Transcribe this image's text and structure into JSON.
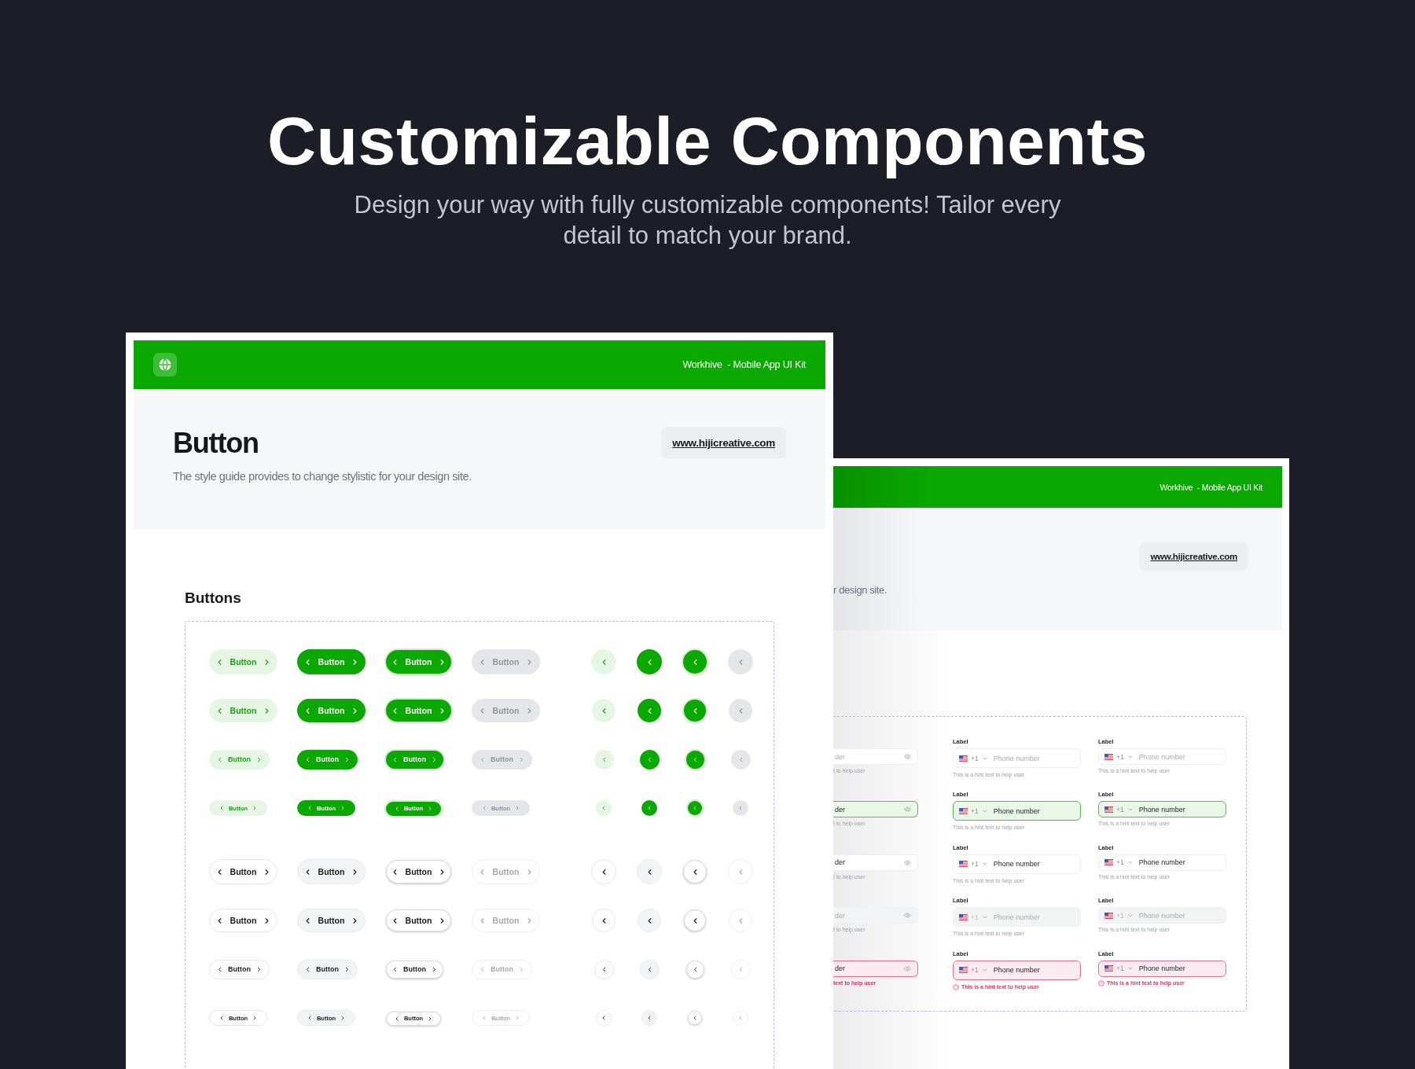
{
  "hero": {
    "title": "Customizable Components",
    "subtitle": "Design your way with fully customizable components! Tailor every detail to match your brand."
  },
  "front_card": {
    "brand": "Workhive  - Mobile App UI Kit",
    "title": "Button",
    "description": "The style guide provides to change stylistic for your design site.",
    "link": "www.hijicreative.com",
    "section_title": "Buttons",
    "button_groups": [
      {
        "rows": [
          {
            "buttons": [
              {
                "label": "Button",
                "disabled": false
              },
              {
                "label": "Button",
                "disabled": false
              },
              {
                "label": "Button",
                "disabled": false
              },
              {
                "label": "Button",
                "disabled": true
              }
            ],
            "icon_buttons": [
              {
                "disabled": false
              },
              {
                "disabled": false
              },
              {
                "disabled": false
              },
              {
                "disabled": true
              }
            ]
          },
          {
            "buttons": [
              {
                "label": "Button",
                "disabled": false
              },
              {
                "label": "Button",
                "disabled": false
              },
              {
                "label": "Button",
                "disabled": false
              },
              {
                "label": "Button",
                "disabled": true
              }
            ],
            "icon_buttons": [
              {
                "disabled": false
              },
              {
                "disabled": false
              },
              {
                "disabled": false
              },
              {
                "disabled": true
              }
            ]
          },
          {
            "buttons": [
              {
                "label": "Button",
                "disabled": false
              },
              {
                "label": "Button",
                "disabled": false
              },
              {
                "label": "Button",
                "disabled": false
              },
              {
                "label": "Button",
                "disabled": true
              }
            ],
            "icon_buttons": [
              {
                "disabled": false
              },
              {
                "disabled": false
              },
              {
                "disabled": false
              },
              {
                "disabled": true
              }
            ]
          },
          {
            "buttons": [
              {
                "label": "Button",
                "disabled": false
              },
              {
                "label": "Button",
                "disabled": false
              },
              {
                "label": "Button",
                "disabled": false
              },
              {
                "label": "Button",
                "disabled": true
              }
            ],
            "icon_buttons": [
              {
                "disabled": false
              },
              {
                "disabled": false
              },
              {
                "disabled": false
              },
              {
                "disabled": true
              }
            ]
          }
        ]
      },
      {
        "rows": [
          {
            "buttons": [
              {
                "label": "Button",
                "disabled": false
              },
              {
                "label": "Button",
                "disabled": false
              },
              {
                "label": "Button",
                "disabled": false
              },
              {
                "label": "Button",
                "disabled": true
              }
            ],
            "icon_buttons": [
              {
                "disabled": false
              },
              {
                "disabled": false
              },
              {
                "disabled": false
              },
              {
                "disabled": true
              }
            ]
          },
          {
            "buttons": [
              {
                "label": "Button",
                "disabled": false
              },
              {
                "label": "Button",
                "disabled": false
              },
              {
                "label": "Button",
                "disabled": false
              },
              {
                "label": "Button",
                "disabled": true
              }
            ],
            "icon_buttons": [
              {
                "disabled": false
              },
              {
                "disabled": false
              },
              {
                "disabled": false
              },
              {
                "disabled": true
              }
            ]
          },
          {
            "buttons": [
              {
                "label": "Button",
                "disabled": false
              },
              {
                "label": "Button",
                "disabled": false
              },
              {
                "label": "Button",
                "disabled": false
              },
              {
                "label": "Button",
                "disabled": true
              }
            ],
            "icon_buttons": [
              {
                "disabled": false
              },
              {
                "disabled": false
              },
              {
                "disabled": false
              },
              {
                "disabled": true
              }
            ]
          },
          {
            "buttons": [
              {
                "label": "Button",
                "disabled": false
              },
              {
                "label": "Button",
                "disabled": false
              },
              {
                "label": "Button",
                "disabled": false
              },
              {
                "label": "Button",
                "disabled": true
              }
            ],
            "icon_buttons": [
              {
                "disabled": false
              },
              {
                "disabled": false
              },
              {
                "disabled": false
              },
              {
                "disabled": true
              }
            ]
          }
        ]
      }
    ]
  },
  "back_card": {
    "brand": "Workhive  - Mobile App UI Kit",
    "link": "www.hijicreative.com",
    "description": "r design site.",
    "field_rows": [
      {
        "kind": "default",
        "password_field": {
          "placeholder": "der",
          "hint": "t to help user"
        },
        "phone_fields": [
          {
            "label": "Label",
            "code": "+1",
            "placeholder": "Phone number",
            "hint": "This is a hint text to help user"
          },
          {
            "label": "Label",
            "code": "+1",
            "placeholder": "Phone number",
            "hint": "This is a hint text to help user"
          }
        ]
      },
      {
        "kind": "focus",
        "password_field": {
          "value": "der",
          "hint": "t to help user"
        },
        "phone_fields": [
          {
            "label": "Label",
            "code": "+1",
            "value": "Phone number",
            "hint": "This is a hint text to help user"
          },
          {
            "label": "Label",
            "code": "+1",
            "value": "Phone number",
            "hint": "This is a hint text to help user"
          }
        ]
      },
      {
        "kind": "filled",
        "password_field": {
          "value": "der",
          "hint": "t to help user"
        },
        "phone_fields": [
          {
            "label": "Label",
            "code": "+1",
            "value": "Phone number",
            "hint": "This is a hint text to help user"
          },
          {
            "label": "Label",
            "code": "+1",
            "value": "Phone number",
            "hint": "This is a hint text to help user"
          }
        ]
      },
      {
        "kind": "disabled",
        "password_field": {
          "placeholder": "der",
          "hint": "t to help user"
        },
        "phone_fields": [
          {
            "label": "Label",
            "code": "+1",
            "placeholder": "Phone number",
            "hint": "This is a hint text to help user"
          },
          {
            "label": "Label",
            "code": "+1",
            "placeholder": "Phone number",
            "hint": "This is a hint text to help user"
          }
        ]
      },
      {
        "kind": "error",
        "password_field": {
          "value": "der",
          "hint": "text to help user"
        },
        "phone_fields": [
          {
            "label": "Label",
            "code": "+1",
            "value": "Phone number",
            "hint": "This is a hint text to help user"
          },
          {
            "label": "Label",
            "code": "+1",
            "value": "Phone number",
            "hint": "This is a hint text to help user"
          }
        ]
      }
    ]
  }
}
